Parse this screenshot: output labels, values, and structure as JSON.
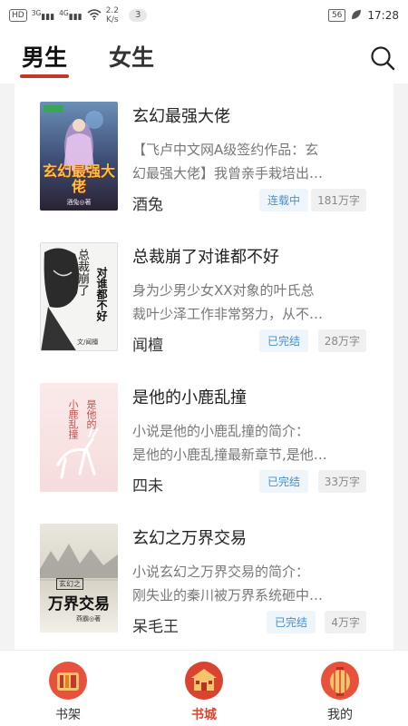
{
  "status_bar": {
    "left_chip": "HD",
    "net1": "3G",
    "net2": "4G",
    "speed_value": "2.2",
    "speed_unit": "K/s",
    "notification_count": "3",
    "battery": "56",
    "time": "17:28"
  },
  "header": {
    "tabs": [
      {
        "label": "男生",
        "active": true
      },
      {
        "label": "女生",
        "active": false
      }
    ]
  },
  "books": [
    {
      "title": "玄幻最强大佬",
      "desc_line1": "【飞卢中文网A级签约作品：玄",
      "desc_line2": "幻最强大佬】我曾亲手栽培出…",
      "author": "酒兔",
      "status": "连载中",
      "words": "181万字",
      "cover_text": "玄幻最强大佬",
      "cover_author": "酒兔◎著"
    },
    {
      "title": "总裁崩了对谁都不好",
      "desc_line1": "身为少男少女XX对象的叶氏总",
      "desc_line2": "裁叶少泽工作非常努力，从不…",
      "author": "闻檀",
      "status": "已完结",
      "words": "28万字",
      "cover_text_a": "总裁崩了",
      "cover_text_b": "对谁都不好",
      "cover_author": "文/闻檀"
    },
    {
      "title": "是他的小鹿乱撞",
      "desc_line1": "小说是他的小鹿乱撞的简介：",
      "desc_line2": "是他的小鹿乱撞最新章节,是他…",
      "author": "四未",
      "status": "已完结",
      "words": "33万字",
      "cover_text_a": "是他的",
      "cover_text_b": "小鹿乱撞"
    },
    {
      "title": "玄幻之万界交易",
      "desc_line1": "小说玄幻之万界交易的简介：",
      "desc_line2": "刚失业的秦川被万界系统砸中…",
      "author": "呆毛王",
      "status": "已完结",
      "words": "4万字",
      "cover_tag": "玄幻之",
      "cover_text": "万界交易",
      "cover_author": "燕霸◎著"
    }
  ],
  "bottom_nav": [
    {
      "label": "书架",
      "icon": "bookshelf-icon"
    },
    {
      "label": "书城",
      "icon": "bookstore-icon",
      "active": true
    },
    {
      "label": "我的",
      "icon": "profile-lantern-icon"
    }
  ],
  "colors": {
    "accent": "#d9432f",
    "status_text": "#4a90c8"
  }
}
